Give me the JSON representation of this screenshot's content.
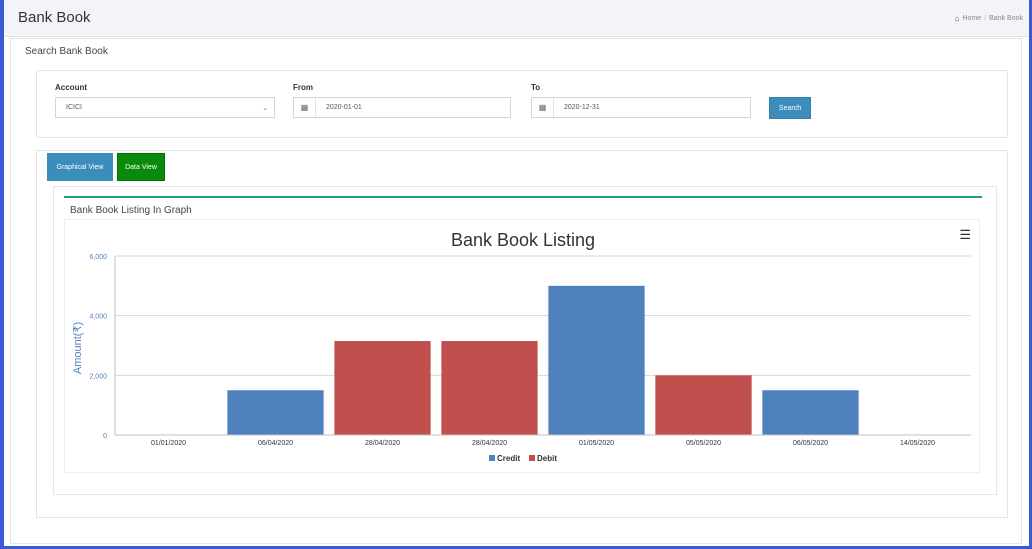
{
  "header": {
    "title": "Bank Book",
    "breadcrumb": {
      "home": "Home",
      "current": "Bank Book"
    }
  },
  "search": {
    "section_title": "Search Bank Book",
    "account_label": "Account",
    "account_value": "ICICI",
    "from_label": "From",
    "from_value": "2020-01-01",
    "to_label": "To",
    "to_value": "2020-12-31",
    "button_label": "Search"
  },
  "tabs": {
    "graphical": "Graphical View",
    "data": "Data View"
  },
  "panel": {
    "title": "Bank Book Listing In Graph"
  },
  "colors": {
    "credit": "#4f81bd",
    "debit": "#c0504d",
    "accent": "#22a06b",
    "primary_button": "#3c8dbc",
    "data_view_button": "#0a8a0a"
  },
  "chart_data": {
    "type": "bar",
    "title": "Bank Book Listing",
    "xlabel": "",
    "ylabel": "Amount(₹)",
    "ylim": [
      0,
      6000
    ],
    "yticks": [
      "0",
      "2,000",
      "4,000",
      "6,000"
    ],
    "ytick_values": [
      0,
      2000,
      4000,
      6000
    ],
    "grid": true,
    "legend": "bottom-center",
    "categories": [
      "01/01/2020",
      "06/04/2020",
      "28/04/2020",
      "28/04/2020",
      "01/05/2020",
      "05/05/2020",
      "06/05/2020",
      "14/05/2020"
    ],
    "series": [
      {
        "name": "Credit",
        "color": "#4f81bd",
        "values": [
          0,
          1500,
          null,
          null,
          5000,
          null,
          1500,
          0
        ]
      },
      {
        "name": "Debit",
        "color": "#c0504d",
        "values": [
          null,
          null,
          3150,
          3150,
          null,
          2000,
          null,
          null
        ]
      }
    ]
  }
}
